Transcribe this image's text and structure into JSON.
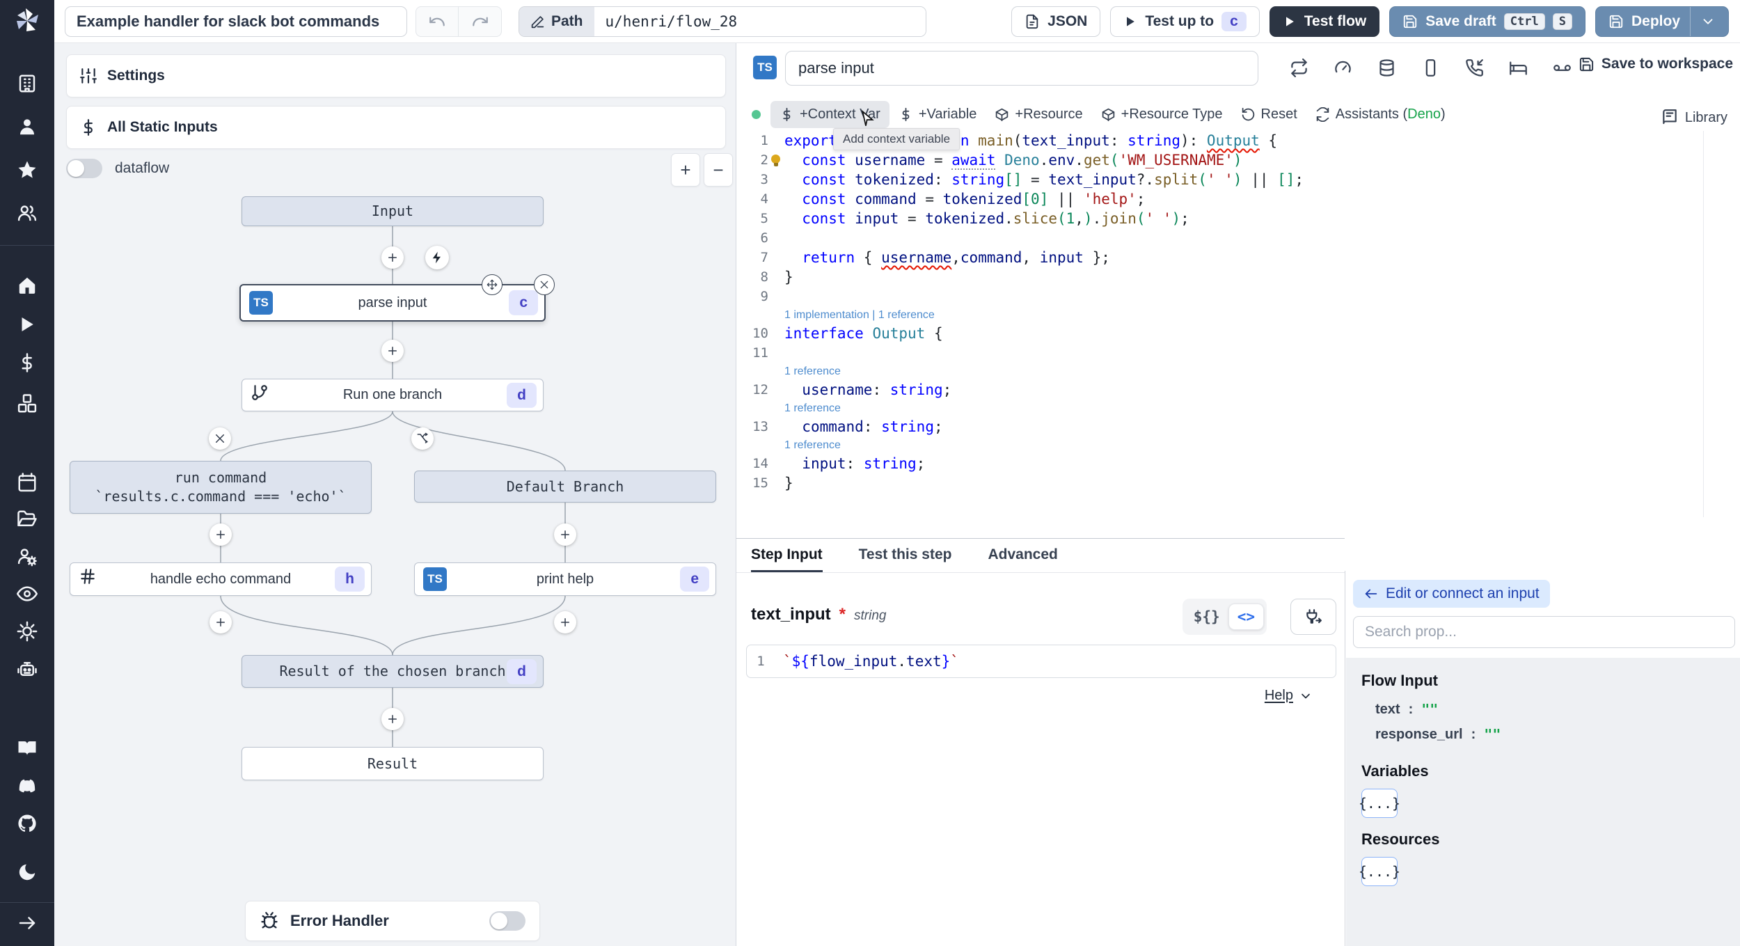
{
  "colors": {
    "sidebar_bg": "#222836",
    "accent_blue": "#6a8cb0",
    "dark_button": "#2c3543",
    "badge_bg": "#e3e6fd",
    "badge_text": "#4340c4",
    "ts_blue": "#3178c6",
    "status_green": "#55c692",
    "deno_green": "#16a34a",
    "edit_btn_bg": "#dbeafe",
    "virtual_node_bg": "#dde3ee",
    "error_red": "#e51400"
  },
  "topbar": {
    "title": "Example handler for slack bot commands",
    "path_label": "Path",
    "path_value": "u/henri/flow_28",
    "json_label": "JSON",
    "test_up_to_label": "Test up to",
    "test_up_to_target": "c",
    "test_flow_label": "Test flow",
    "save_draft_label": "Save draft",
    "save_kbd_1": "Ctrl",
    "save_kbd_2": "S",
    "deploy_label": "Deploy"
  },
  "sidebar": {
    "icons": [
      "building",
      "user",
      "star",
      "users",
      "home",
      "play",
      "dollar",
      "cubes",
      "calendar",
      "folder",
      "users-gear",
      "eye",
      "gear",
      "robot",
      "book",
      "discord",
      "github",
      "moon",
      "arrow-right"
    ]
  },
  "flow_panel": {
    "settings_label": "Settings",
    "static_inputs_label": "All Static Inputs",
    "dataflow_label": "dataflow",
    "zoom_in": "+",
    "zoom_out": "−",
    "error_handler_label": "Error Handler",
    "nodes": {
      "input": {
        "label": "Input"
      },
      "parse_input": {
        "label": "parse input",
        "badge": "c",
        "lang": "TS"
      },
      "run_one_branch": {
        "label": "Run one branch",
        "badge": "d"
      },
      "run_command": {
        "label": "run command",
        "sublabel": "`results.c.command === 'echo'`"
      },
      "default_branch": {
        "label": "Default Branch"
      },
      "handle_echo": {
        "label": "handle echo command",
        "badge": "h"
      },
      "print_help": {
        "label": "print help",
        "badge": "e",
        "lang": "TS"
      },
      "result_chosen": {
        "label": "Result of the chosen branch",
        "badge": "d"
      },
      "result": {
        "label": "Result"
      }
    }
  },
  "editor": {
    "lang_badge": "TS",
    "step_name": "parse input",
    "header_icons": [
      "repeat",
      "gauge",
      "database",
      "smartphone",
      "phone-incoming",
      "bed",
      "voicemail"
    ],
    "save_to_workspace": "Save to workspace",
    "toolbar": {
      "context_var": "+Context Var",
      "variable": "+Variable",
      "resource": "+Resource",
      "resource_type": "+Resource Type",
      "reset": "Reset",
      "assistants_prefix": "Assistants (",
      "assistants_lang": "Deno",
      "assistants_suffix": ")",
      "library": "Library"
    },
    "tooltip": "Add context variable",
    "code_lines": [
      {
        "num": 1,
        "tokens": [
          [
            "kw",
            "export async function "
          ],
          [
            "fn",
            "main"
          ],
          [
            "pl",
            "("
          ],
          [
            "var",
            "text_input"
          ],
          [
            "pl",
            ": "
          ],
          [
            "kw",
            "string"
          ],
          [
            "pl",
            "): "
          ],
          [
            "type sqg",
            "Output"
          ],
          [
            "pl",
            " {"
          ]
        ]
      },
      {
        "num": 2,
        "bulb": true,
        "tokens": [
          [
            "pl",
            "  "
          ],
          [
            "kw",
            "const "
          ],
          [
            "var",
            "username"
          ],
          [
            "pl",
            " = "
          ],
          [
            "kw dot",
            "await"
          ],
          [
            "pl",
            " "
          ],
          [
            "type",
            "Deno"
          ],
          [
            "pl",
            "."
          ],
          [
            "var",
            "env"
          ],
          [
            "pl",
            "."
          ],
          [
            "fn",
            "get"
          ],
          [
            "num",
            "("
          ],
          [
            "str",
            "'WM_USERNAME'"
          ],
          [
            "num",
            ")"
          ]
        ]
      },
      {
        "num": 3,
        "tokens": [
          [
            "pl",
            "  "
          ],
          [
            "kw",
            "const "
          ],
          [
            "var",
            "tokenized"
          ],
          [
            "pl",
            ": "
          ],
          [
            "kw",
            "string"
          ],
          [
            "num",
            "[]"
          ],
          [
            "pl",
            " = "
          ],
          [
            "var",
            "text_input"
          ],
          [
            "pl",
            "?."
          ],
          [
            "fn",
            "split"
          ],
          [
            "num",
            "("
          ],
          [
            "str",
            "' '"
          ],
          [
            "num",
            ")"
          ],
          [
            "pl",
            " || "
          ],
          [
            "num",
            "[]"
          ],
          [
            "pl",
            ";"
          ]
        ]
      },
      {
        "num": 4,
        "tokens": [
          [
            "pl",
            "  "
          ],
          [
            "kw",
            "const "
          ],
          [
            "var",
            "command"
          ],
          [
            "pl",
            " = "
          ],
          [
            "var",
            "tokenized"
          ],
          [
            "num",
            "[0]"
          ],
          [
            "pl",
            " || "
          ],
          [
            "str",
            "'help'"
          ],
          [
            "pl",
            ";"
          ]
        ]
      },
      {
        "num": 5,
        "tokens": [
          [
            "pl",
            "  "
          ],
          [
            "kw",
            "const "
          ],
          [
            "var",
            "input"
          ],
          [
            "pl",
            " = "
          ],
          [
            "var",
            "tokenized"
          ],
          [
            "pl",
            "."
          ],
          [
            "fn",
            "slice"
          ],
          [
            "num",
            "("
          ],
          [
            "num",
            "1"
          ],
          [
            "pl",
            ","
          ],
          [
            "num",
            ")"
          ],
          [
            "pl",
            "."
          ],
          [
            "fn",
            "join"
          ],
          [
            "num",
            "("
          ],
          [
            "str",
            "' '"
          ],
          [
            "num",
            ")"
          ],
          [
            "pl",
            ";"
          ]
        ]
      },
      {
        "num": 6,
        "tokens": []
      },
      {
        "num": 7,
        "tokens": [
          [
            "pl",
            "  "
          ],
          [
            "kw",
            "return"
          ],
          [
            "pl",
            " { "
          ],
          [
            "var sqg",
            "username"
          ],
          [
            "pl",
            ","
          ],
          [
            "var",
            "command"
          ],
          [
            "pl",
            ", "
          ],
          [
            "var",
            "input"
          ],
          [
            "pl",
            " };"
          ]
        ]
      },
      {
        "num": 8,
        "tokens": [
          [
            "pl",
            "}"
          ]
        ]
      },
      {
        "num": 9,
        "tokens": []
      },
      {
        "num": 10,
        "lens": "1 implementation | 1 reference",
        "tokens": [
          [
            "kw",
            "interface "
          ],
          [
            "type",
            "Output"
          ],
          [
            "pl",
            " {"
          ]
        ]
      },
      {
        "num": 11,
        "tokens": [
          [
            "pl",
            "  "
          ]
        ]
      },
      {
        "num": 12,
        "lens": "1 reference",
        "tokens": [
          [
            "pl",
            "  "
          ],
          [
            "var",
            "username"
          ],
          [
            "pl",
            ": "
          ],
          [
            "kw",
            "string"
          ],
          [
            "pl",
            ";"
          ]
        ]
      },
      {
        "num": 13,
        "lens": "1 reference",
        "tokens": [
          [
            "pl",
            "  "
          ],
          [
            "var",
            "command"
          ],
          [
            "pl",
            ": "
          ],
          [
            "kw",
            "string"
          ],
          [
            "pl",
            ";"
          ]
        ]
      },
      {
        "num": 14,
        "lens": "1 reference",
        "tokens": [
          [
            "pl",
            "  "
          ],
          [
            "var",
            "input"
          ],
          [
            "pl",
            ": "
          ],
          [
            "kw",
            "string"
          ],
          [
            "pl",
            ";"
          ]
        ]
      },
      {
        "num": 15,
        "tokens": [
          [
            "pl",
            "}"
          ]
        ]
      }
    ]
  },
  "bottom_panel": {
    "tabs": [
      "Step Input",
      "Test this step",
      "Advanced"
    ],
    "field_name": "text_input",
    "required_mark": "*",
    "field_type": "string",
    "toggle_template": "${}",
    "toggle_code": "<>",
    "expr_line_number": "1",
    "expr_tokens": [
      [
        "str",
        "`"
      ],
      [
        "kw",
        "${"
      ],
      [
        "var",
        "flow_input"
      ],
      [
        "pl",
        "."
      ],
      [
        "var",
        "text"
      ],
      [
        "kw",
        "}"
      ],
      [
        "str",
        "`"
      ]
    ],
    "help_label": "Help"
  },
  "prop_panel": {
    "edit_button_label": "Edit or connect an input",
    "search_placeholder": "Search prop...",
    "flow_input_title": "Flow Input",
    "flow_input_rows": [
      {
        "key": "text",
        "value": "\"\""
      },
      {
        "key": "response_url",
        "value": "\"\""
      }
    ],
    "variables_title": "Variables",
    "variables_chip": "{...}",
    "resources_title": "Resources",
    "resources_chip": "{...}"
  }
}
